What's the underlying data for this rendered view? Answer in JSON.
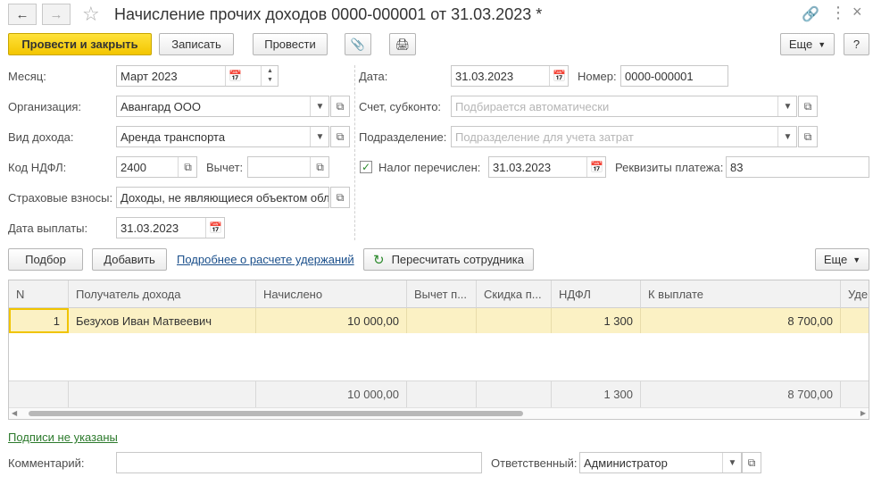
{
  "window": {
    "title": "Начисление прочих доходов 0000-000001 от 31.03.2023 *",
    "back_icon": "arrow-left-icon",
    "forward_icon": "arrow-right-icon",
    "star_icon": "star-icon",
    "link_icon": "link-icon",
    "menu_icon": "more-vertical-icon",
    "close_icon": "close-icon"
  },
  "toolbar": {
    "post_close_label": "Провести и закрыть",
    "save_label": "Записать",
    "post_label": "Провести",
    "more_label": "Еще",
    "help_label": "?"
  },
  "form": {
    "month_label": "Месяц:",
    "month_value": "Март 2023",
    "org_label": "Организация:",
    "org_value": "Авангард ООО",
    "income_type_label": "Вид дохода:",
    "income_type_value": "Аренда транспорта",
    "ndfl_code_label": "Код НДФЛ:",
    "ndfl_code_value": "2400",
    "deduction_label": "Вычет:",
    "deduction_value": "",
    "insurance_label": "Страховые взносы:",
    "insurance_value": "Доходы, не являющиеся объектом обл",
    "pay_date_label": "Дата выплаты:",
    "pay_date_value": "31.03.2023",
    "date_label": "Дата:",
    "date_value": "31.03.2023",
    "number_label": "Номер:",
    "number_value": "0000-000001",
    "account_label": "Счет, субконто:",
    "account_placeholder": "Подбирается автоматически",
    "division_label": "Подразделение:",
    "division_placeholder": "Подразделение для учета затрат",
    "tax_paid_label": "Налог перечислен:",
    "tax_paid_checked": true,
    "tax_paid_date": "31.03.2023",
    "payment_details_label": "Реквизиты платежа:",
    "payment_details_value": "83"
  },
  "table_toolbar": {
    "select_label": "Подбор",
    "add_label": "Добавить",
    "details_link": "Подробнее о расчете удержаний",
    "recalc_label": "Пересчитать сотрудника",
    "more_label": "Еще"
  },
  "table": {
    "columns": [
      "N",
      "Получатель дохода",
      "Начислено",
      "Вычет п...",
      "Скидка п...",
      "НДФЛ",
      "К выплате",
      "Уде"
    ],
    "rows": [
      [
        "1",
        "Безухов Иван Матвеевич",
        "10 000,00",
        "",
        "",
        "1 300",
        "8 700,00",
        ""
      ]
    ],
    "totals": [
      "",
      "",
      "10 000,00",
      "",
      "",
      "1 300",
      "8 700,00",
      ""
    ]
  },
  "footer": {
    "signatures_link": "Подписи не указаны",
    "comment_label": "Комментарий:",
    "comment_value": "",
    "responsible_label": "Ответственный:",
    "responsible_value": "Администратор"
  },
  "colors": {
    "accent": "#f3c500",
    "selected_row": "#fbf1c4",
    "link": "#1a4f8b",
    "link_green": "#2c7a2c"
  }
}
